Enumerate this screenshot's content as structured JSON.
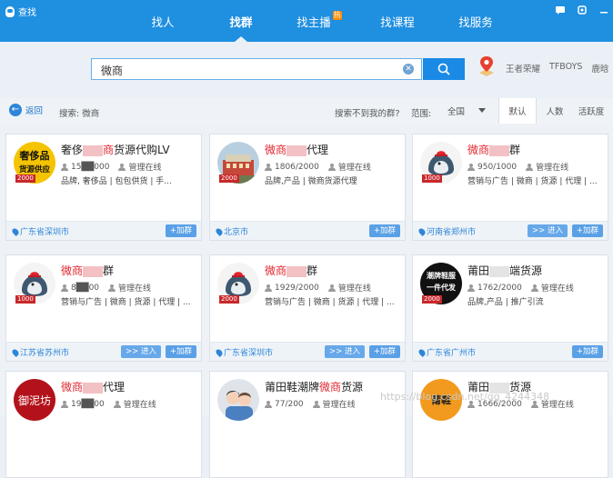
{
  "window": {
    "title": "查找",
    "controls": [
      "message-icon",
      "skin-icon",
      "minimize-icon"
    ]
  },
  "nav": {
    "tabs": [
      {
        "label": "找人",
        "active": false
      },
      {
        "label": "找群",
        "active": true
      },
      {
        "label": "找主播",
        "active": false,
        "badge": "热"
      },
      {
        "label": "找课程",
        "active": false
      },
      {
        "label": "找服务",
        "active": false
      }
    ]
  },
  "search": {
    "value": "微商",
    "placeholder": "",
    "hotwords": [
      "王者荣耀",
      "TFBOYS",
      "鹿晗"
    ]
  },
  "filter": {
    "back_label": "返回",
    "hint": "搜索: 微商",
    "not_found": "搜索不到我的群?",
    "range_label": "范围:",
    "range_value": "全国",
    "sorts": [
      {
        "label": "默认",
        "active": true
      },
      {
        "label": "人数",
        "active": false
      },
      {
        "label": "活跃度",
        "active": false
      }
    ]
  },
  "cards": [
    {
      "name_parts": [
        "奢侈",
        "",
        "商",
        "货源代购LV"
      ],
      "name_hl": [
        false,
        false,
        true,
        false
      ],
      "members": "15██000",
      "admin": "管理在线",
      "tags": "品牌,  奢侈品 | 包包供货 | 手...",
      "level": "2000",
      "location": "广东省深圳市",
      "enter": false,
      "avatar": "luxury"
    },
    {
      "name_parts": [
        "微商",
        "",
        "代理"
      ],
      "name_hl": [
        true,
        false,
        false
      ],
      "members": "1806/2000",
      "admin": "管理在线",
      "tags": "品牌,产品 | 微商货源代理",
      "level": "2000",
      "location": "北京市",
      "enter": false,
      "avatar": "building"
    },
    {
      "name_parts": [
        "微商",
        "",
        "群"
      ],
      "name_hl": [
        true,
        false,
        false
      ],
      "members": "950/1000",
      "admin": "管理在线",
      "tags": "营销与广告 | 微商 | 货源 | 代理 | ...",
      "level": "1000",
      "location": "河南省郑州市",
      "enter": true,
      "avatar": "penguin"
    },
    {
      "name_parts": [
        "微商",
        "",
        "群"
      ],
      "name_hl": [
        true,
        false,
        false
      ],
      "members": "8██00",
      "admin": "管理在线",
      "tags": "营销与广告 | 微商 | 货源 | 代理 | ...",
      "level": "1000",
      "location": "江苏省苏州市",
      "enter": true,
      "avatar": "penguin"
    },
    {
      "name_parts": [
        "微商",
        "",
        "群"
      ],
      "name_hl": [
        true,
        false,
        false
      ],
      "members": "1929/2000",
      "admin": "管理在线",
      "tags": "营销与广告 | 微商 | 货源 | 代理 | ...",
      "level": "2000",
      "location": "广东省深圳市",
      "enter": true,
      "avatar": "penguin"
    },
    {
      "name_parts": [
        "莆田",
        "",
        "端货源"
      ],
      "name_hl": [
        false,
        false,
        false
      ],
      "members": "1762/2000",
      "admin": "管理在线",
      "tags": "品牌,产品 | 推广引流",
      "level": "2000",
      "location": "广东省广州市",
      "enter": false,
      "avatar": "shoes"
    },
    {
      "name_parts": [
        "微商",
        "",
        "代理"
      ],
      "name_hl": [
        true,
        false,
        false
      ],
      "members": "19██00",
      "admin": "管理在线",
      "tags": "",
      "level": "",
      "location": "",
      "enter": false,
      "avatar": "red"
    },
    {
      "name_parts": [
        "莆田鞋潮牌",
        "微商",
        "货源"
      ],
      "name_hl": [
        false,
        true,
        false
      ],
      "members": "77/200",
      "admin": "管理在线",
      "tags": "",
      "level": "",
      "location": "",
      "enter": false,
      "avatar": "couple"
    },
    {
      "name_parts": [
        "莆田",
        "",
        "货源"
      ],
      "name_hl": [
        false,
        false,
        false
      ],
      "members": "1666/2000",
      "admin": "管理在线",
      "tags": "",
      "level": "",
      "location": "",
      "enter": false,
      "avatar": "orange"
    }
  ],
  "labels": {
    "join": "+加群",
    "enter": ">> 进入"
  },
  "avatar_texts": {
    "luxury": [
      "奢侈品",
      "货源供应"
    ],
    "shoes": [
      "潮牌鞋服",
      "一件代发"
    ],
    "red": "御泥坊",
    "orange": "莆鞋"
  },
  "watermark": "https://blog.csdn.net/qq_4244348",
  "colors": {
    "accent": "#1f8fe0",
    "highlight": "#e2242c",
    "level": "#c8282a"
  }
}
